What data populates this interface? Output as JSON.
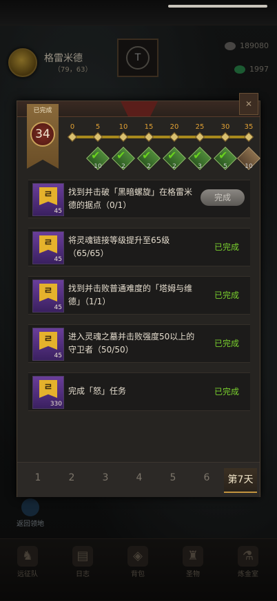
{
  "hud": {
    "location_name": "格雷米德",
    "location_coords": "（79，63）",
    "resource_1": "189080",
    "resource_2": "1997"
  },
  "panel": {
    "completed_badge": "已完成",
    "points": "34",
    "milestones": [
      "0",
      "5",
      "10",
      "15",
      "20",
      "25",
      "30",
      "35"
    ],
    "rewards": [
      {
        "count": "10",
        "claimed": true
      },
      {
        "count": "2",
        "claimed": true
      },
      {
        "count": "2",
        "claimed": true
      },
      {
        "count": "2",
        "claimed": true
      },
      {
        "count": "3",
        "claimed": true
      },
      {
        "count": "5",
        "claimed": true
      },
      {
        "count": "10",
        "claimed": false
      }
    ],
    "tasks": [
      {
        "text": "找到并击破「黑暗螺旋」在格雷米德的据点（0/1）",
        "points": "45",
        "status": "完成",
        "done": false
      },
      {
        "text": "将灵魂链接等级提升至65级（65/65）",
        "points": "45",
        "status": "已完成",
        "done": true
      },
      {
        "text": "找到并击败普通难度的「塔姆与维德」（1/1）",
        "points": "45",
        "status": "已完成",
        "done": true
      },
      {
        "text": "进入灵魂之墓并击败强度50以上的守卫者（50/50）",
        "points": "45",
        "status": "已完成",
        "done": true
      },
      {
        "text": "完成「怒」任务",
        "points": "330",
        "status": "已完成",
        "done": true
      }
    ],
    "day_tabs": [
      "1",
      "2",
      "3",
      "4",
      "5",
      "6",
      "第7天"
    ],
    "active_tab": "第7天"
  },
  "return_label": "返回领地",
  "nav": [
    "远征队",
    "日志",
    "背包",
    "圣物",
    "炼金室"
  ],
  "colors": {
    "accent_gold": "#e3a234",
    "done_green": "#7ad12e",
    "panel_bg": "#262421"
  }
}
